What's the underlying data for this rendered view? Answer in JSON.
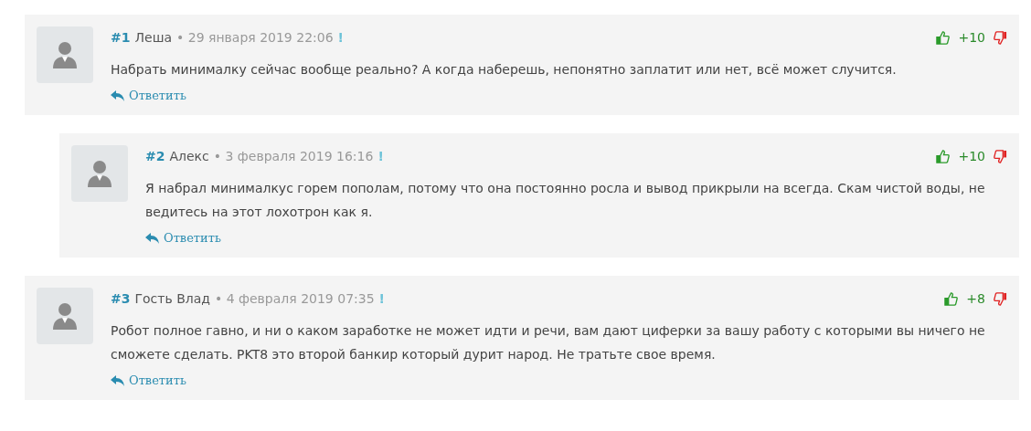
{
  "comments": [
    {
      "number": "#1",
      "author": "Леша",
      "date": "• 29 января 2019 22:06",
      "flag": "!",
      "score": "+10",
      "text": "Набрать минималку сейчас вообще реально? А когда наберешь, непонятно заплатит или нет, всё может случится.",
      "reply": "Ответить",
      "children": [
        {
          "number": "#2",
          "author": "Алекс",
          "date": "• 3 февраля 2019 16:16",
          "flag": "!",
          "score": "+10",
          "text": "Я набрал минималкус горем пополам, потому что она постоянно росла и вывод прикрыли на всегда. Скам чистой воды, не ведитесь на этот лохотрон как я.",
          "reply": "Ответить"
        }
      ]
    },
    {
      "number": "#3",
      "author": "Гость Влад",
      "date": "• 4 февраля 2019 07:35",
      "flag": "!",
      "score": "+8",
      "text": "Робот полное гавно, и ни о каком заработке не может идти и речи, вам дают циферки за вашу работу с которыми вы ничего не сможете сделать. PKT8 это второй банкир который дурит народ. Не тратьте свое время.",
      "reply": "Ответить"
    }
  ]
}
